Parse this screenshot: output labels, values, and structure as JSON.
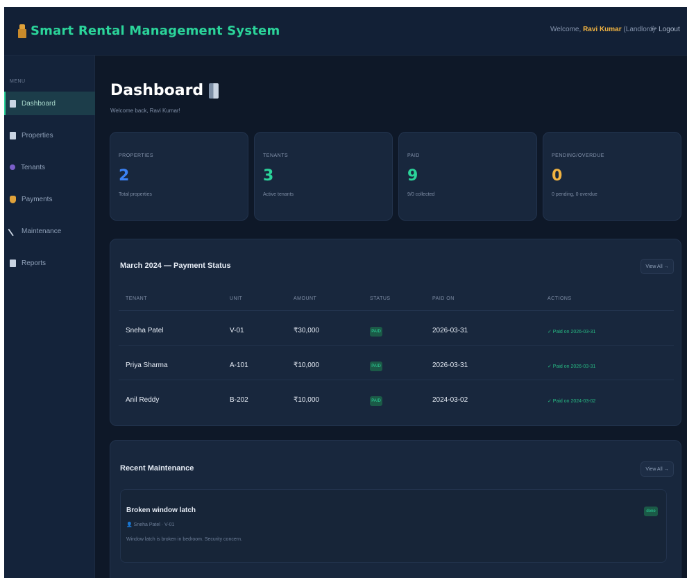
{
  "header": {
    "brand_title": "Smart Rental Management System",
    "welcome_prefix": "Welcome,",
    "user_name": "Ravi Kumar",
    "user_role": "(Landlord)",
    "logout_label": "↩ Logout"
  },
  "sidebar": {
    "menu_label": "MENU",
    "items": [
      {
        "label": "Dashboard",
        "icon": "dashboard-icon",
        "active": true
      },
      {
        "label": "Properties",
        "icon": "building-icon"
      },
      {
        "label": "Tenants",
        "icon": "users-icon"
      },
      {
        "label": "Payments",
        "icon": "money-icon"
      },
      {
        "label": "Maintenance",
        "icon": "wrench-icon"
      },
      {
        "label": "Reports",
        "icon": "report-icon"
      }
    ]
  },
  "page": {
    "title": "Dashboard",
    "subtitle": "Welcome back, Ravi Kumar!"
  },
  "stats": [
    {
      "label": "PROPERTIES",
      "value": "2",
      "sub": "Total properties",
      "color": "#3b82f6"
    },
    {
      "label": "TENANTS",
      "value": "3",
      "sub": "Active tenants",
      "color": "#2bd49a"
    },
    {
      "label": "PAID",
      "value": "9",
      "sub": "9/0 collected",
      "color": "#2bd49a"
    },
    {
      "label": "PENDING/OVERDUE",
      "value": "0",
      "sub": "0 pending, 0 overdue",
      "color": "#f2b441"
    }
  ],
  "payments": {
    "title": "March 2024 — Payment Status",
    "view_all": "View All →",
    "columns": [
      "TENANT",
      "UNIT",
      "AMOUNT",
      "STATUS",
      "PAID ON",
      "ACTIONS"
    ],
    "rows": [
      {
        "tenant": "Sneha Patel",
        "unit": "V-01",
        "amount": "₹30,000",
        "status": "PAID",
        "paid_on": "2026-03-31",
        "action": "✓ Paid on 2026-03-31"
      },
      {
        "tenant": "Priya Sharma",
        "unit": "A-101",
        "amount": "₹10,000",
        "status": "PAID",
        "paid_on": "2026-03-31",
        "action": "✓ Paid on 2026-03-31"
      },
      {
        "tenant": "Anil Reddy",
        "unit": "B-202",
        "amount": "₹10,000",
        "status": "PAID",
        "paid_on": "2024-03-02",
        "action": "✓ Paid on 2024-03-02"
      }
    ]
  },
  "maintenance": {
    "title": "Recent Maintenance",
    "view_all": "View All →",
    "items": [
      {
        "title": "Broken window latch",
        "meta": "👤 Sneha Patel · V-01",
        "desc": "Window latch is broken in bedroom. Security concern.",
        "status": "done"
      }
    ]
  },
  "colors": {
    "accent": "#2bd49a",
    "brand": "#2bd49a",
    "user": "#f2b441",
    "blue": "#3b82f6"
  }
}
